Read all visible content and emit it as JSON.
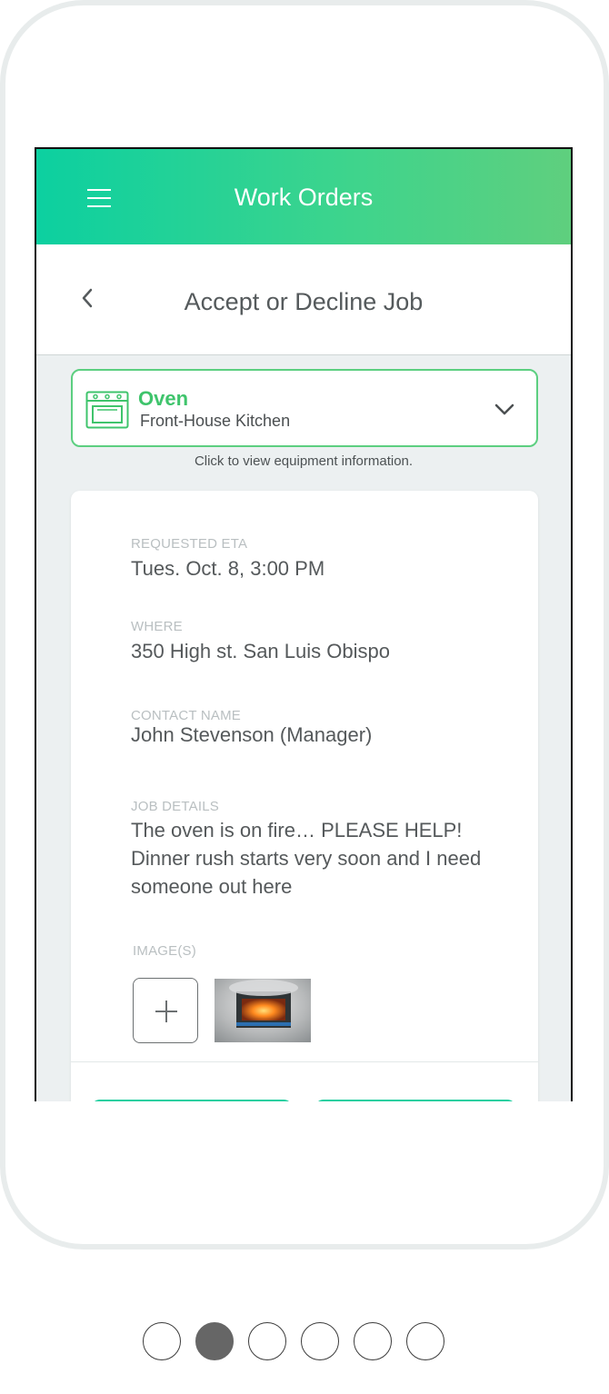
{
  "header": {
    "title": "Work Orders",
    "menu_icon": "hamburger-menu-icon"
  },
  "subheader": {
    "title": "Accept or Decline Job",
    "back_icon": "chevron-left-icon"
  },
  "equipment": {
    "name": "Oven",
    "location": "Front-House Kitchen",
    "hint": "Click to view equipment information.",
    "icon": "oven-icon",
    "expand_icon": "chevron-down-icon"
  },
  "details": {
    "eta_label": "REQUESTED ETA",
    "eta_value": "Tues. Oct. 8, 3:00 PM",
    "where_label": "WHERE",
    "where_value": "350 High st. San Luis Obispo",
    "contact_label": "CONTACT NAME",
    "contact_value": "John Stevenson (Manager)",
    "job_label": "JOB DETAILS",
    "job_value": "The oven is on fire… PLEASE HELP! Dinner rush starts very soon and I need someone out here",
    "images_label": "IMAGE(S)"
  },
  "pagination": {
    "total": 6,
    "active_index": 1
  },
  "colors": {
    "header_gradient_start": "#0cd0a0",
    "header_gradient_end": "#5fcf7e",
    "accent_green": "#3fc46c",
    "button_border": "#21cfa0",
    "background": "#ecf0f1"
  }
}
